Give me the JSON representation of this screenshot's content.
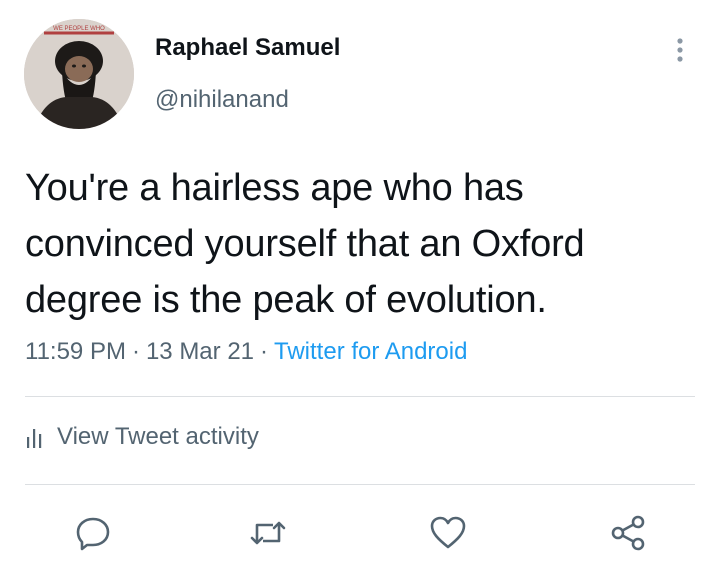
{
  "tweet": {
    "author": {
      "display_name": "Raphael Samuel",
      "handle": "@nihilanand",
      "avatar_icon": "profile-photo",
      "avatar_caption": "WE PEOPLE WHO"
    },
    "more_icon": "more-vertical-icon",
    "text": "You're a hairless ape who has convinced yourself that an Oxford degree is the peak of evolution.",
    "time": "11:59 PM",
    "separator": "·",
    "date": "13 Mar 21",
    "source": "Twitter for Android",
    "activity": {
      "icon": "bar-chart-icon",
      "label": "View Tweet activity"
    },
    "actions": [
      {
        "icon": "reply-icon"
      },
      {
        "icon": "retweet-icon"
      },
      {
        "icon": "like-icon"
      },
      {
        "icon": "share-icon"
      }
    ]
  },
  "colors": {
    "text_primary": "#0f1419",
    "text_secondary": "#536471",
    "link": "#1d9bf0",
    "divider": "#dcdfe2",
    "background": "#ffffff"
  }
}
